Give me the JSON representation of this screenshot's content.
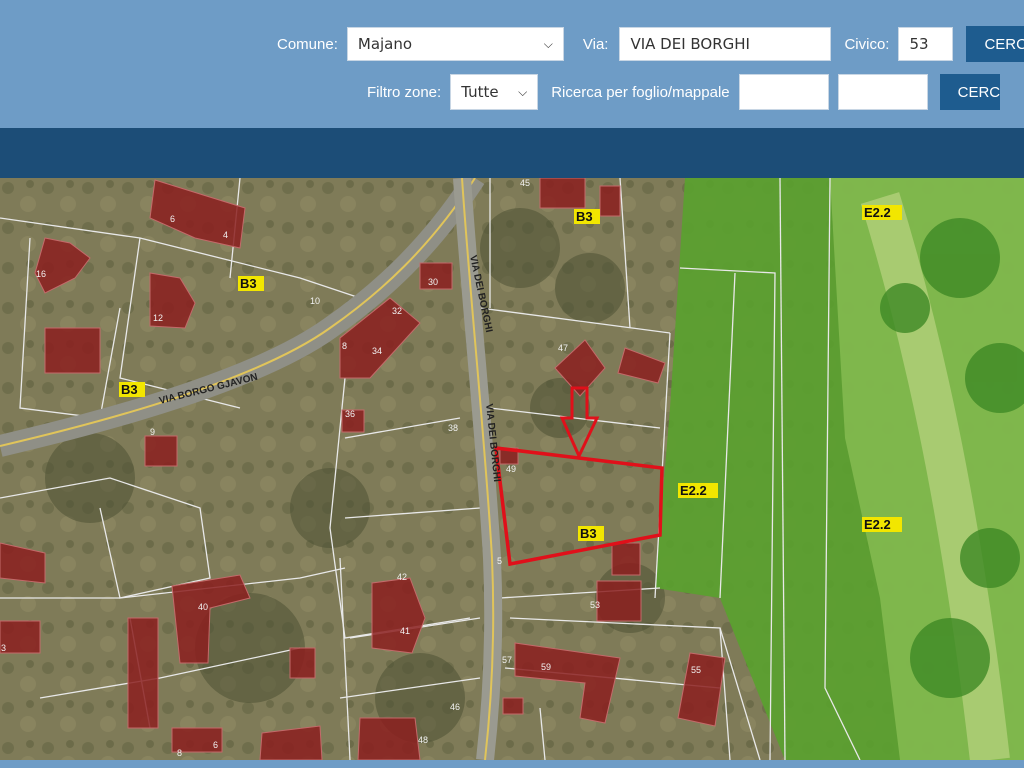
{
  "header": {
    "comune_label": "Comune:",
    "comune_value": "Majano",
    "via_label": "Via:",
    "via_value": "VIA DEI BORGHI",
    "civico_label": "Civico:",
    "civico_value": "53",
    "search_button": "CERC",
    "filtro_label": "Filtro zone:",
    "filtro_value": "Tutte",
    "ricerca_label": "Ricerca per foglio/mappale",
    "foglio_value": "",
    "mappale_value": "",
    "search_button2": "CERC"
  },
  "map": {
    "roads": {
      "via_borgo_gjavon": "VIA BORGO GJAVON",
      "via_dei_borghi_1": "VIA DEI BORGHI",
      "via_dei_borghi_2": "VIA DEI BORGHI"
    },
    "zones": [
      "B3",
      "B3",
      "B3",
      "B3",
      "E2.2",
      "E2.2",
      "E2.2"
    ],
    "house_numbers": [
      "45",
      "6",
      "4",
      "16",
      "12",
      "10",
      "30",
      "32",
      "8",
      "34",
      "47",
      "36",
      "38",
      "9",
      "49",
      "5",
      "42",
      "40",
      "41",
      "53",
      "3",
      "57",
      "59",
      "55",
      "46",
      "8",
      "6",
      "48"
    ],
    "colors": {
      "building": "#8b1e1e",
      "parcel_highlight": "#e0101a",
      "zone_label_bg": "#f2e600",
      "green_zone": "#5aa12f"
    }
  }
}
